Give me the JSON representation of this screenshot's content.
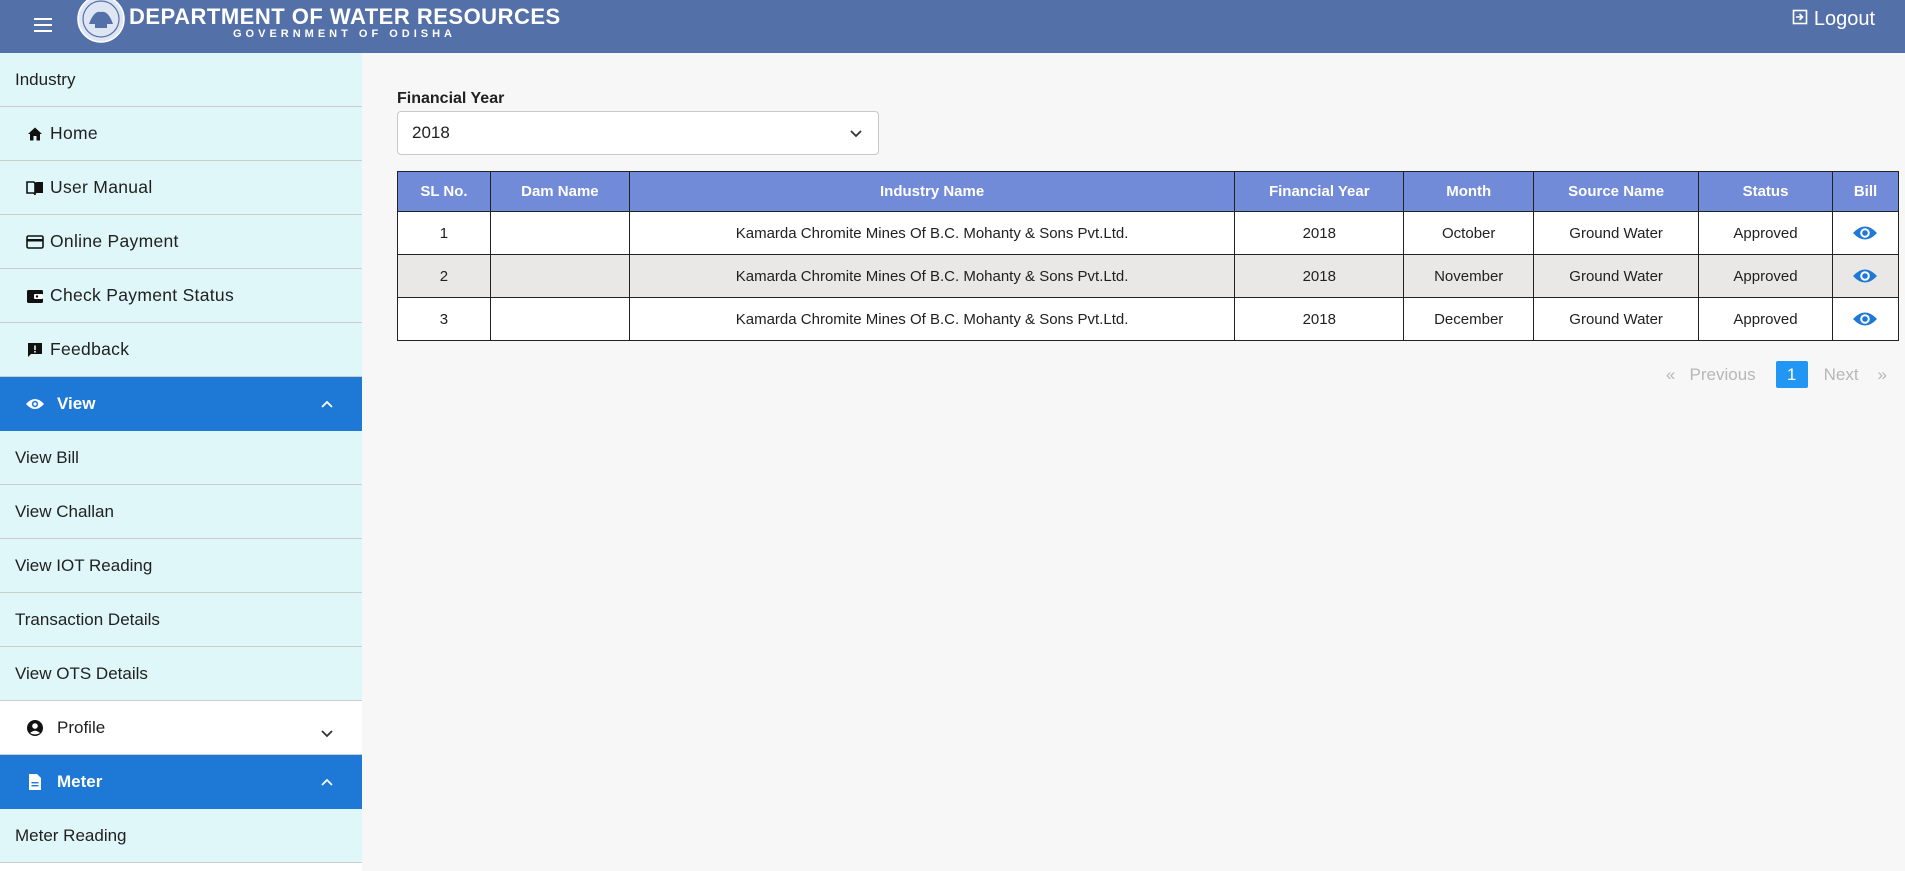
{
  "header": {
    "title": "DEPARTMENT OF WATER RESOURCES",
    "subtitle": "GOVERNMENT OF ODISHA",
    "logout_label": "Logout",
    "color": "#5470a8"
  },
  "sidebar": {
    "items": [
      {
        "label": "Industry",
        "level": 0
      },
      {
        "label": "Home",
        "icon": "home-icon"
      },
      {
        "label": "User Manual",
        "icon": "book-icon"
      },
      {
        "label": "Online Payment",
        "icon": "credit-card-icon"
      },
      {
        "label": "Check Payment Status",
        "icon": "wallet-icon"
      },
      {
        "label": "Feedback",
        "icon": "feedback-icon"
      }
    ],
    "view_group": {
      "label": "View",
      "icon": "eye-icon",
      "expanded": true,
      "color": "#1e78d6"
    },
    "view_items": [
      "View Bill",
      "View Challan",
      "View IOT Reading",
      "Transaction Details",
      "View OTS Details"
    ],
    "profile_group": {
      "label": "Profile",
      "icon": "account-circle-icon",
      "expanded": false
    },
    "meter_group": {
      "label": "Meter",
      "icon": "document-icon",
      "expanded": true
    },
    "meter_items": [
      "Meter Reading"
    ]
  },
  "filter": {
    "label": "Financial Year",
    "value": "2018"
  },
  "table": {
    "headers": [
      "SL No.",
      "Dam Name",
      "Industry Name",
      "Financial Year",
      "Month",
      "Source Name",
      "Status",
      "Bill"
    ],
    "rows": [
      {
        "sl": "1",
        "dam": "",
        "industry": "Kamarda Chromite Mines Of B.C. Mohanty & Sons Pvt.Ltd.",
        "year": "2018",
        "month": "October",
        "source": "Ground Water",
        "status": "Approved"
      },
      {
        "sl": "2",
        "dam": "",
        "industry": "Kamarda Chromite Mines Of B.C. Mohanty & Sons Pvt.Ltd.",
        "year": "2018",
        "month": "November",
        "source": "Ground Water",
        "status": "Approved"
      },
      {
        "sl": "3",
        "dam": "",
        "industry": "Kamarda Chromite Mines Of B.C. Mohanty & Sons Pvt.Ltd.",
        "year": "2018",
        "month": "December",
        "source": "Ground Water",
        "status": "Approved"
      }
    ],
    "header_color": "#728bd8"
  },
  "pagination": {
    "prev_label": "Previous",
    "prev_glyph": "«",
    "current": "1",
    "next_label": "Next",
    "next_glyph": "»",
    "active_color": "#2196f3"
  }
}
